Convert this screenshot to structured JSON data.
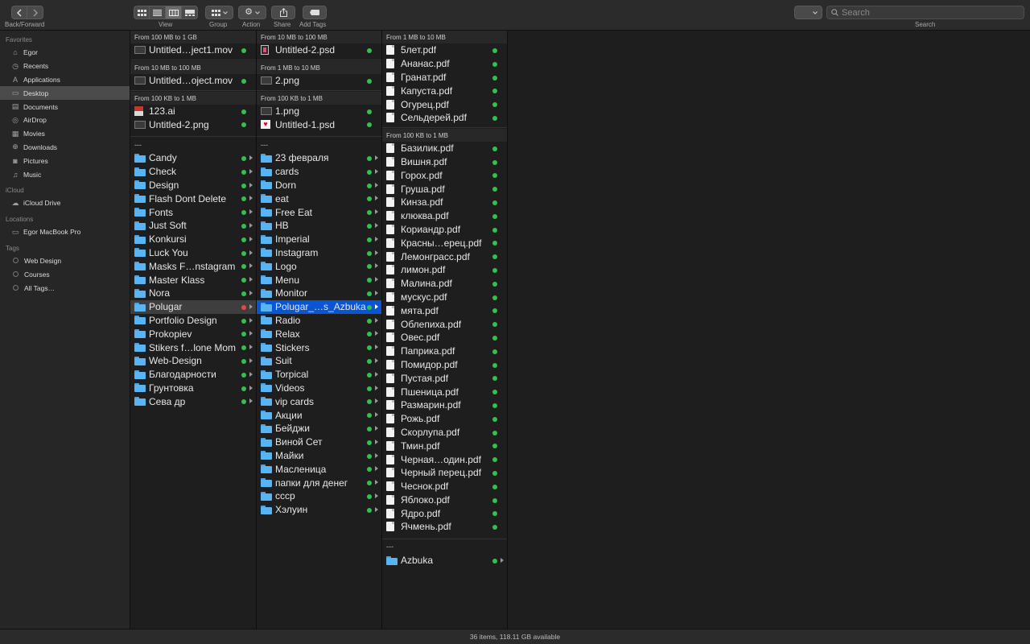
{
  "toolbar": {
    "back_forward_label": "Back/Forward",
    "view_label": "View",
    "group_label": "Group",
    "action_label": "Action",
    "share_label": "Share",
    "add_tags_label": "Add Tags",
    "search_label": "Search",
    "search_placeholder": "Search",
    "active_view": "columns"
  },
  "sidebar": {
    "favorites_header": "Favorites",
    "favorites": [
      {
        "label": "Egor",
        "icon": "home-icon"
      },
      {
        "label": "Recents",
        "icon": "clock-icon"
      },
      {
        "label": "Applications",
        "icon": "applications-icon"
      },
      {
        "label": "Desktop",
        "icon": "desktop-icon"
      },
      {
        "label": "Documents",
        "icon": "document-icon"
      },
      {
        "label": "AirDrop",
        "icon": "airdrop-icon"
      },
      {
        "label": "Movies",
        "icon": "film-icon"
      },
      {
        "label": "Downloads",
        "icon": "download-icon"
      },
      {
        "label": "Pictures",
        "icon": "camera-icon"
      },
      {
        "label": "Music",
        "icon": "music-note-icon"
      }
    ],
    "selected_favorite": "Desktop",
    "icloud_header": "iCloud",
    "icloud": [
      {
        "label": "iCloud Drive",
        "icon": "cloud-icon"
      }
    ],
    "locations_header": "Locations",
    "locations": [
      {
        "label": "Egor MacBook Pro",
        "icon": "laptop-icon"
      }
    ],
    "tags_header": "Tags",
    "tags": [
      {
        "label": "Web Design"
      },
      {
        "label": "Courses"
      },
      {
        "label": "All Tags…"
      }
    ]
  },
  "columns": [
    {
      "groups": [
        {
          "header": "From 100 MB to 1 GB",
          "items": [
            {
              "name": "Untitled…ject1.mov",
              "icon": "video-thumb-icon",
              "status": "ok"
            }
          ]
        },
        {
          "header": "From 10 MB to 100 MB",
          "items": [
            {
              "name": "Untitled…oject.mov",
              "icon": "video-thumb-icon",
              "status": "ok"
            }
          ]
        },
        {
          "header": "From 100 KB to 1 MB",
          "items": [
            {
              "name": "123.ai",
              "icon": "ai-file-icon",
              "status": "ok"
            },
            {
              "name": "Untitled-2.png",
              "icon": "image-thumb-icon",
              "status": "ok"
            }
          ]
        }
      ],
      "dashes": "---",
      "folders": [
        {
          "name": "Candy",
          "status": "ok"
        },
        {
          "name": "Check",
          "status": "ok"
        },
        {
          "name": "Design",
          "status": "ok"
        },
        {
          "name": "Flash Dont Delete",
          "status": "ok"
        },
        {
          "name": "Fonts",
          "status": "ok"
        },
        {
          "name": "Just Soft",
          "status": "ok"
        },
        {
          "name": "Konkursi",
          "status": "ok"
        },
        {
          "name": "Luck You",
          "status": "ok"
        },
        {
          "name": "Masks F…nstagram",
          "status": "ok"
        },
        {
          "name": "Master Klass",
          "status": "ok"
        },
        {
          "name": "Nora",
          "status": "ok"
        },
        {
          "name": "Polugar",
          "status": "err",
          "state": "gray"
        },
        {
          "name": "Portfolio Design",
          "status": "ok"
        },
        {
          "name": "Prokopiev",
          "status": "ok"
        },
        {
          "name": "Stikers f…lone Mom",
          "status": "ok"
        },
        {
          "name": "Web-Design",
          "status": "ok"
        },
        {
          "name": "Благодарности",
          "status": "ok"
        },
        {
          "name": "Грунтовка",
          "status": "ok"
        },
        {
          "name": "Сева др",
          "status": "ok"
        }
      ]
    },
    {
      "groups": [
        {
          "header": "From 10 MB to 100 MB",
          "items": [
            {
              "name": "Untitled-2.psd",
              "icon": "psd-thumb-icon",
              "status": "ok"
            }
          ]
        },
        {
          "header": "From 1 MB to 10 MB",
          "items": [
            {
              "name": "2.png",
              "icon": "image-thumb-icon",
              "status": "ok"
            }
          ]
        },
        {
          "header": "From 100 KB to 1 MB",
          "items": [
            {
              "name": "1.png",
              "icon": "image-thumb-icon",
              "status": "ok"
            },
            {
              "name": "Untitled-1.psd",
              "icon": "heart-thumb-icon",
              "status": "ok"
            }
          ]
        }
      ],
      "dashes": "---",
      "folders": [
        {
          "name": "23 февраля",
          "status": "ok"
        },
        {
          "name": "cards",
          "status": "ok"
        },
        {
          "name": "Dorn",
          "status": "ok"
        },
        {
          "name": "eat",
          "status": "ok"
        },
        {
          "name": "Free Eat",
          "status": "ok"
        },
        {
          "name": "HB",
          "status": "ok"
        },
        {
          "name": "Imperial",
          "status": "ok"
        },
        {
          "name": "Instagram",
          "status": "ok"
        },
        {
          "name": "Logo",
          "status": "ok"
        },
        {
          "name": "Menu",
          "status": "ok"
        },
        {
          "name": "Monitor",
          "status": "ok"
        },
        {
          "name": "Polugar_…s_Azbuka",
          "status": "ok",
          "state": "blue"
        },
        {
          "name": "Radio",
          "status": "ok"
        },
        {
          "name": "Relax",
          "status": "ok"
        },
        {
          "name": "Stickers",
          "status": "ok"
        },
        {
          "name": "Suit",
          "status": "ok"
        },
        {
          "name": "Torpical",
          "status": "ok"
        },
        {
          "name": "Videos",
          "status": "ok"
        },
        {
          "name": "vip cards",
          "status": "ok"
        },
        {
          "name": "Акции",
          "status": "ok"
        },
        {
          "name": "Бейджи",
          "status": "ok"
        },
        {
          "name": "Виной Сет",
          "status": "ok"
        },
        {
          "name": "Майки",
          "status": "ok"
        },
        {
          "name": "Масленица",
          "status": "ok"
        },
        {
          "name": "папки для денег",
          "status": "ok"
        },
        {
          "name": "сccp",
          "status": "ok"
        },
        {
          "name": "Хэлуин",
          "status": "ok"
        }
      ]
    },
    {
      "groups": [
        {
          "header": "From 1 MB to 10 MB",
          "items": [
            {
              "name": "5лет.pdf"
            },
            {
              "name": "Ананас.pdf"
            },
            {
              "name": "Гранат.pdf"
            },
            {
              "name": "Капуста.pdf"
            },
            {
              "name": "Огурец.pdf"
            },
            {
              "name": "Сельдерей.pdf"
            }
          ]
        },
        {
          "header": "From 100 KB to 1 MB",
          "items": [
            {
              "name": "Базилик.pdf"
            },
            {
              "name": "Вишня.pdf"
            },
            {
              "name": "Горох.pdf"
            },
            {
              "name": "Груша.pdf"
            },
            {
              "name": "Кинза.pdf"
            },
            {
              "name": "клюква.pdf"
            },
            {
              "name": "Кориандр.pdf"
            },
            {
              "name": "Красны…ерец.pdf"
            },
            {
              "name": "Лемонграсс.pdf"
            },
            {
              "name": "лимон.pdf"
            },
            {
              "name": "Малина.pdf"
            },
            {
              "name": "мускус.pdf"
            },
            {
              "name": "мята.pdf"
            },
            {
              "name": "Облепиха.pdf"
            },
            {
              "name": "Овес.pdf"
            },
            {
              "name": "Паприка.pdf"
            },
            {
              "name": "Помидор.pdf"
            },
            {
              "name": "Пустая.pdf"
            },
            {
              "name": "Пшеница.pdf"
            },
            {
              "name": "Размарин.pdf"
            },
            {
              "name": "Рожь.pdf"
            },
            {
              "name": "Скорлупа.pdf"
            },
            {
              "name": "Тмин.pdf"
            },
            {
              "name": "Черная…один.pdf"
            },
            {
              "name": "Черный перец.pdf"
            },
            {
              "name": "Чеснок.pdf"
            },
            {
              "name": "Яблоко.pdf"
            },
            {
              "name": "Ядро.pdf"
            },
            {
              "name": "Ячмень.pdf"
            }
          ]
        }
      ],
      "dashes": "---",
      "folders": [
        {
          "name": "Azbuka",
          "status": "ok"
        }
      ]
    }
  ],
  "statusbar": {
    "text": "36 items, 118.11 GB available"
  },
  "colors": {
    "selection_blue": "#0a55d2",
    "status_green": "#2fc24e",
    "status_red": "#e54848",
    "folder_blue": "#58b4f2"
  }
}
